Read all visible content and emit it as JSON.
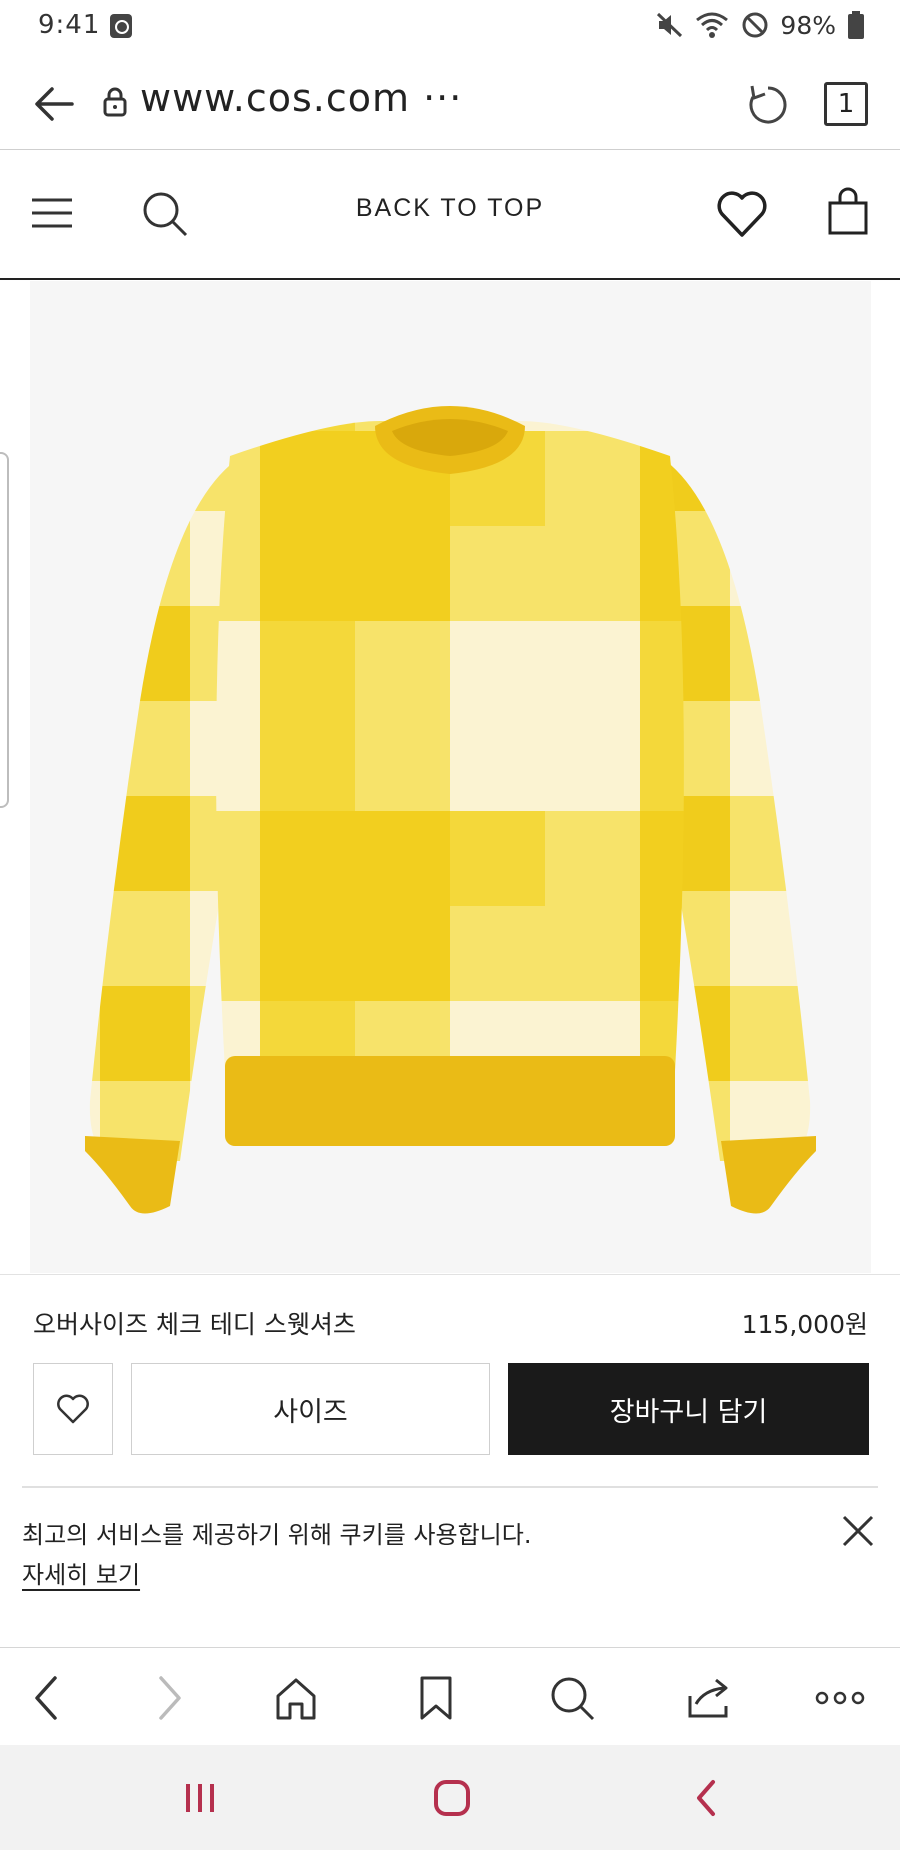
{
  "status_bar": {
    "time": "9:41",
    "battery_text": "98%"
  },
  "address_bar": {
    "url": "www.cos.com ···",
    "tab_count": "1"
  },
  "site_header": {
    "back_to_top": "BACK TO TOP"
  },
  "product": {
    "name": "오버사이즈 체크 테디 스웻셔츠",
    "price": "115,000원",
    "size_label": "사이즈",
    "cart_label": "장바구니 담기",
    "colors": {
      "main_yellow": "#f2cf1f",
      "light_yellow": "#f7e36a",
      "cream": "#fbf3d2",
      "rib": "#eabb16"
    }
  },
  "cookie_banner": {
    "message": "최고의 서비스를 제공하기 위해 쿠키를 사용합니다.",
    "link": "자세히 보기"
  },
  "icons": {
    "back": "arrow-left-icon",
    "lock": "lock-icon",
    "reload": "reload-icon",
    "menu": "hamburger-icon",
    "search": "search-icon",
    "wishlist": "heart-icon",
    "bag": "shopping-bag-icon",
    "home": "home-icon",
    "bookmark": "bookmark-icon",
    "share": "share-icon",
    "more": "more-icon"
  }
}
